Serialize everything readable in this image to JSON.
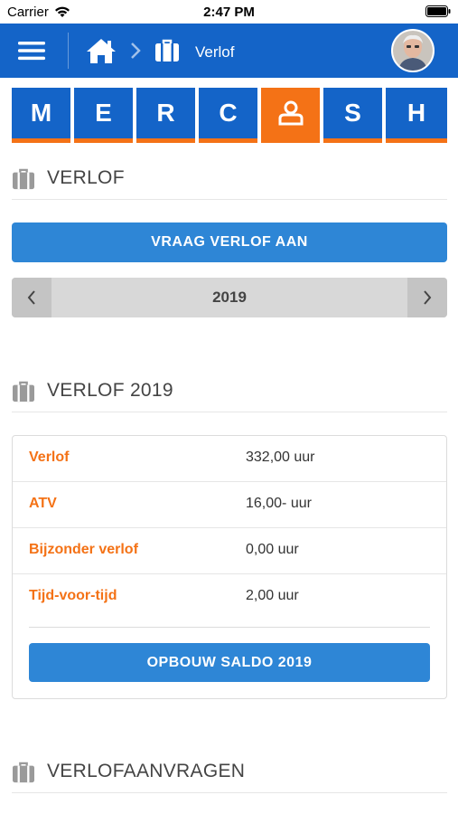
{
  "status_bar": {
    "carrier": "Carrier",
    "time": "2:47 PM"
  },
  "nav": {
    "breadcrumb_label": "Verlof"
  },
  "tabs": [
    {
      "letter": "M",
      "active": false
    },
    {
      "letter": "E",
      "active": false
    },
    {
      "letter": "R",
      "active": false
    },
    {
      "letter": "C",
      "active": false
    },
    {
      "letter": "",
      "icon": "person-icon",
      "active": true
    },
    {
      "letter": "S",
      "active": false
    },
    {
      "letter": "H",
      "active": false
    }
  ],
  "sections": {
    "verlof": {
      "title": "VERLOF"
    },
    "verlof_year": {
      "title": "VERLOF 2019"
    },
    "aanvragen": {
      "title": "VERLOFAANVRAGEN"
    }
  },
  "actions": {
    "request_leave": "VRAAG VERLOF AAN",
    "build_balance": "OPBOUW SALDO 2019"
  },
  "year_selector": {
    "year": "2019"
  },
  "balances": [
    {
      "label": "Verlof",
      "value": "332,00 uur"
    },
    {
      "label": "ATV",
      "value": "16,00- uur"
    },
    {
      "label": "Bijzonder verlof",
      "value": "0,00 uur"
    },
    {
      "label": "Tijd-voor-tijd",
      "value": "2,00 uur"
    }
  ],
  "colors": {
    "brand_blue": "#1464c8",
    "accent_orange": "#f47216",
    "button_blue": "#2e86d6"
  }
}
